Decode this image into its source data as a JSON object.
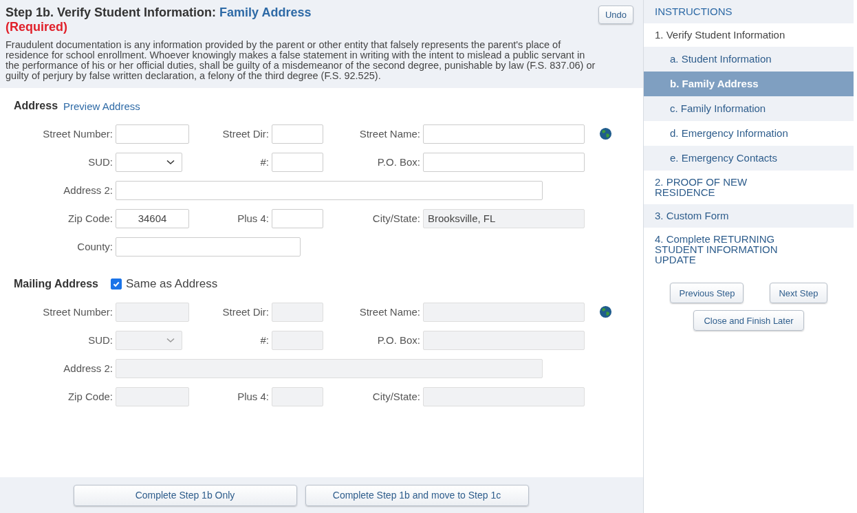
{
  "header": {
    "title": "Step 1b. Verify Student Information:",
    "title_highlight": "Family Address",
    "required": "(Required)",
    "undo": "Undo",
    "notice": "Fraudulent documentation is any information provided by the parent or other entity that falsely represents the parent's place of residence for school enrollment. Whoever knowingly makes a false statement in writing with the intent to mislead a public servant in the performance of his or her official duties, shall be guilty of a misdemeanor of the second degree, punishable by law (F.S. 837.06) or guilty of perjury by false written declaration, a felony of the third degree (F.S. 92.525)."
  },
  "sections": [
    {
      "title": "Address",
      "link": "Preview Address",
      "rows": [
        [
          {
            "label": "Street Number:",
            "kind": "text",
            "disabled": false
          },
          {
            "label": "Street Dir:",
            "kind": "text",
            "disabled": false
          },
          {
            "label": "Street Name:",
            "kind": "text",
            "disabled": false
          }
        ],
        [
          {
            "label": "SUD:",
            "kind": "select",
            "disabled": false
          },
          {
            "label": "#:",
            "kind": "text",
            "disabled": false
          },
          {
            "label": "P.O. Box:",
            "kind": "text",
            "disabled": false
          }
        ],
        [
          {
            "label": "Address 2:",
            "kind": "wide",
            "disabled": false
          }
        ],
        [
          {
            "label": "Zip Code:",
            "kind": "text",
            "value": "34604",
            "disabled": false
          },
          {
            "label": "Plus 4:",
            "kind": "text",
            "disabled": false
          },
          {
            "label": "City/State:",
            "kind": "text",
            "value": "Brooksville, FL",
            "disabled": true
          }
        ],
        [
          {
            "label": "County:",
            "kind": "medium",
            "disabled": false
          }
        ]
      ]
    },
    {
      "title": "Mailing Address",
      "checkbox": {
        "label": "Same as Address",
        "checked": true
      },
      "rows": [
        [
          {
            "label": "Street Number:",
            "kind": "text",
            "disabled": true
          },
          {
            "label": "Street Dir:",
            "kind": "text",
            "disabled": true
          },
          {
            "label": "Street Name:",
            "kind": "text",
            "disabled": true
          }
        ],
        [
          {
            "label": "SUD:",
            "kind": "select",
            "disabled": true
          },
          {
            "label": "#:",
            "kind": "text",
            "disabled": true
          },
          {
            "label": "P.O. Box:",
            "kind": "text",
            "disabled": true
          }
        ],
        [
          {
            "label": "Address 2:",
            "kind": "wide",
            "disabled": true
          }
        ],
        [
          {
            "label": "Zip Code:",
            "kind": "text",
            "disabled": true
          },
          {
            "label": "Plus 4:",
            "kind": "text",
            "disabled": true
          },
          {
            "label": "City/State:",
            "kind": "text",
            "disabled": true
          }
        ]
      ]
    }
  ],
  "footer_buttons": [
    "Complete Step 1b Only",
    "Complete Step 1b and move to Step 1c"
  ],
  "sidebar": {
    "title": "INSTRUCTIONS",
    "items": [
      {
        "label": "1. Verify Student Information",
        "selected": false,
        "children": [
          {
            "label": "a. Student Information",
            "selected": false
          },
          {
            "label": "b. Family Address",
            "selected": true
          },
          {
            "label": "c. Family Information",
            "selected": false
          },
          {
            "label": "d. Emergency Information",
            "selected": false
          },
          {
            "label": "e. Emergency Contacts",
            "selected": false
          }
        ]
      },
      {
        "label": "2. PROOF OF NEW RESIDENCE",
        "selected": false
      },
      {
        "label": "3. Custom Form",
        "selected": false
      },
      {
        "label": "4. Complete RETURNING STUDENT INFORMATION UPDATE",
        "selected": false
      }
    ],
    "buttons": [
      "Previous Step",
      "Next Step"
    ],
    "finish": "Close and Finish Later"
  }
}
